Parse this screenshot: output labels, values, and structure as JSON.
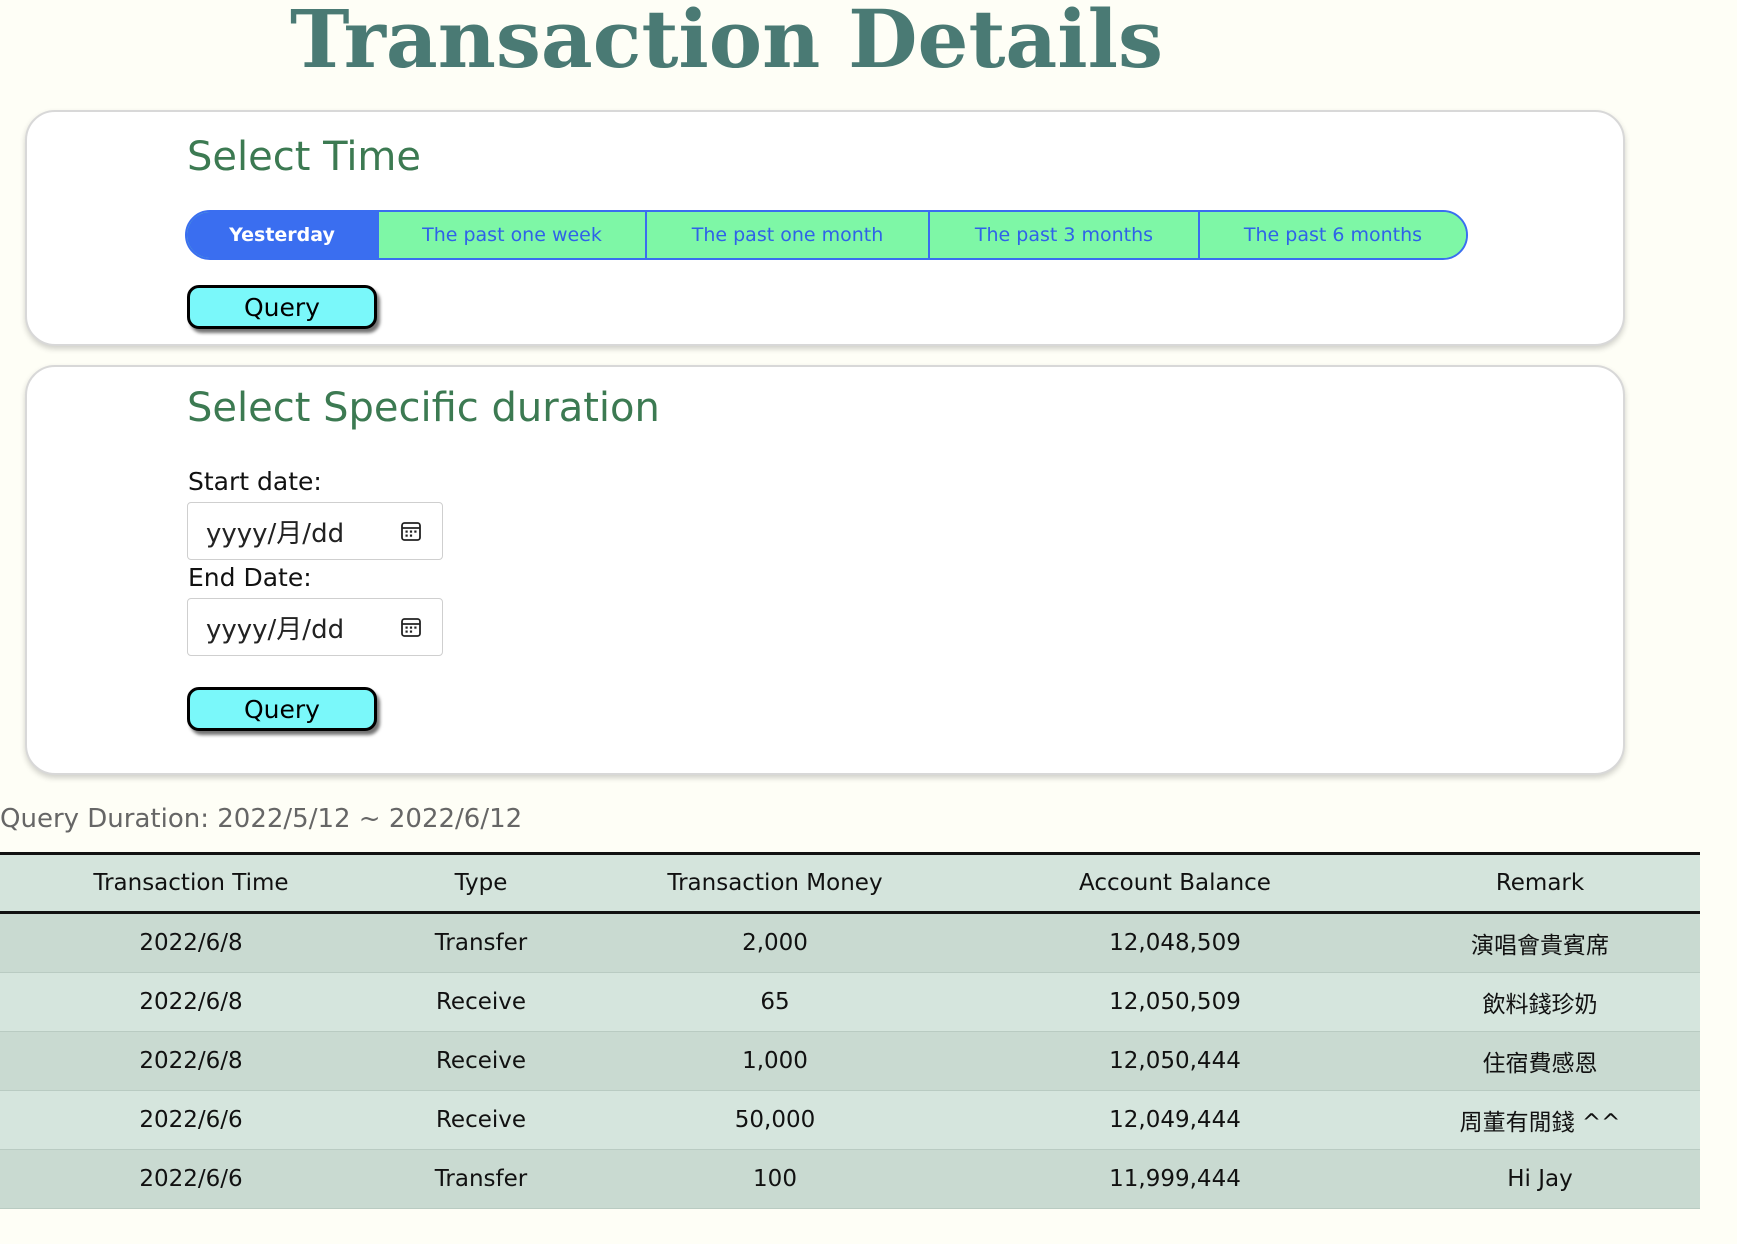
{
  "page": {
    "title": "Transaction Details"
  },
  "select_time": {
    "heading": "Select Time",
    "options": [
      {
        "label": "Yesterday",
        "active": true
      },
      {
        "label": "The past one week",
        "active": false
      },
      {
        "label": "The past one month",
        "active": false
      },
      {
        "label": "The past 3 months",
        "active": false
      },
      {
        "label": "The past 6 months",
        "active": false
      }
    ],
    "query_label": "Query"
  },
  "specific_duration": {
    "heading": "Select Specific duration",
    "start_label": "Start date:",
    "start_placeholder": "yyyy/月/dd",
    "end_label": "End Date:",
    "end_placeholder": "yyyy/月/dd",
    "calendar_icon": "calendar-icon",
    "query_label": "Query"
  },
  "results": {
    "query_duration": "Query Duration: 2022/5/12 ~ 2022/6/12",
    "columns": [
      "Transaction Time",
      "Type",
      "Transaction Money",
      "Account Balance",
      "Remark"
    ],
    "rows": [
      [
        "2022/6/8",
        "Transfer",
        "2,000",
        "12,048,509",
        "演唱會貴賓席"
      ],
      [
        "2022/6/8",
        "Receive",
        "65",
        "12,050,509",
        "飲料錢珍奶"
      ],
      [
        "2022/6/8",
        "Receive",
        "1,000",
        "12,050,444",
        "住宿費感恩"
      ],
      [
        "2022/6/6",
        "Receive",
        "50,000",
        "12,049,444",
        "周董有閒錢 ^^"
      ],
      [
        "2022/6/6",
        "Transfer",
        "100",
        "11,999,444",
        "Hi Jay"
      ]
    ]
  },
  "colors": {
    "background": "#fefef6",
    "title": "#4a7a74",
    "heading": "#3c7a52",
    "segment_active": "#3a6ef0",
    "segment_inactive": "#7ef7a6",
    "query_button": "#7af8fa",
    "table_header": "#d4e4dc"
  }
}
